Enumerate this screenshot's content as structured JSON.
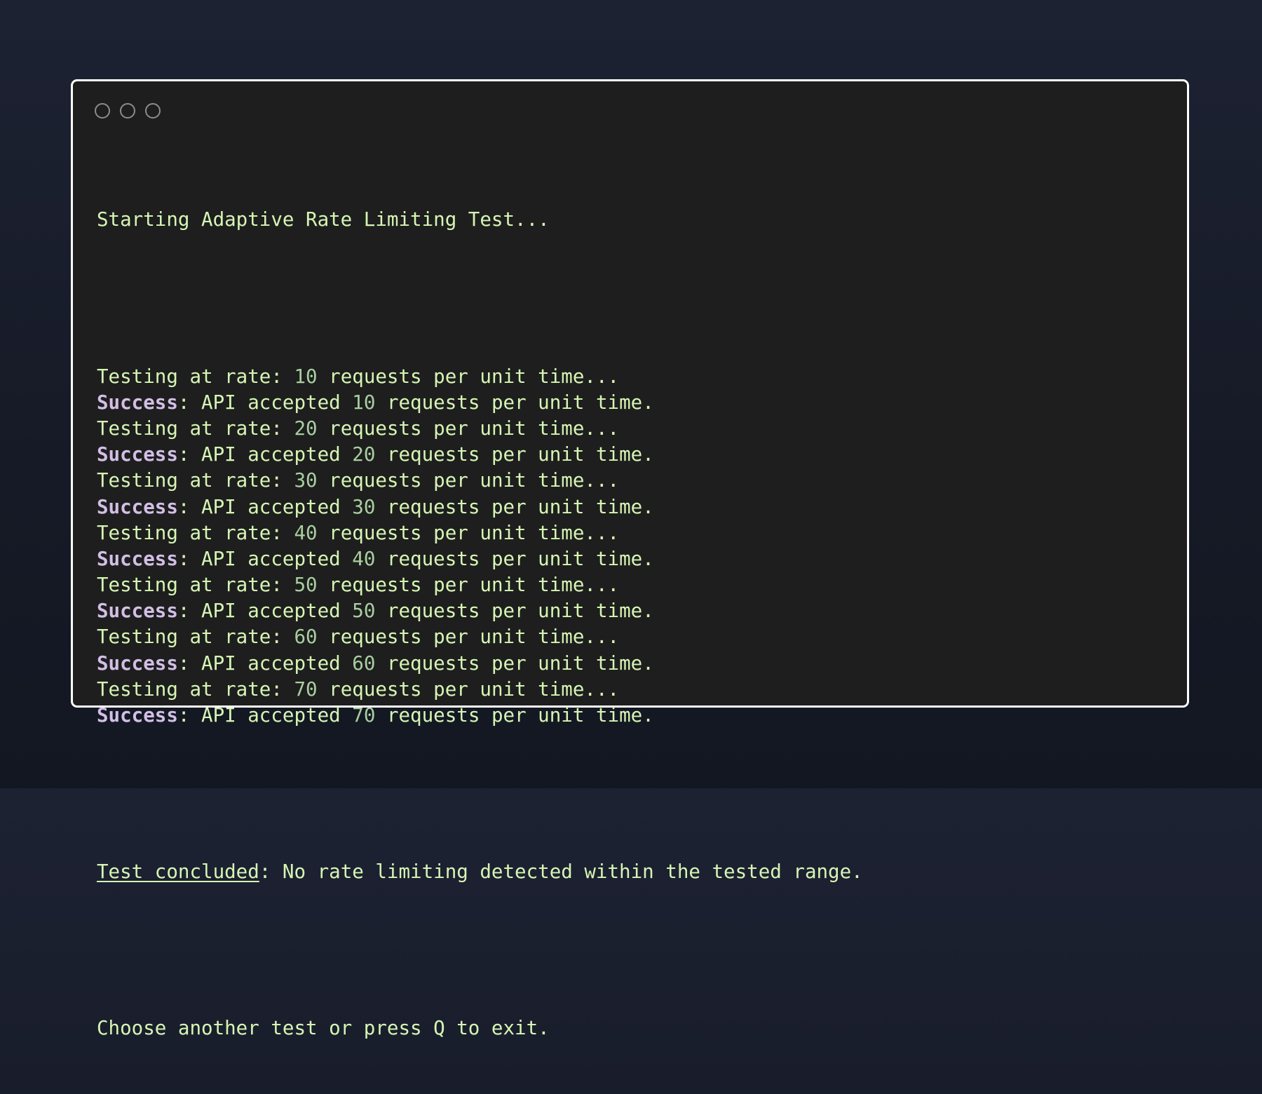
{
  "window": {
    "controls": [
      "close",
      "minimize",
      "maximize"
    ]
  },
  "output": {
    "header": "Starting Adaptive Rate Limiting Test...",
    "tests": [
      {
        "testing_prefix": "Testing at rate: ",
        "rate": "10",
        "testing_suffix": " requests per unit time...",
        "success_label": "Success",
        "success_mid": ": API accepted ",
        "accepted": "10",
        "success_suffix": " requests per unit time."
      },
      {
        "testing_prefix": "Testing at rate: ",
        "rate": "20",
        "testing_suffix": " requests per unit time...",
        "success_label": "Success",
        "success_mid": ": API accepted ",
        "accepted": "20",
        "success_suffix": " requests per unit time."
      },
      {
        "testing_prefix": "Testing at rate: ",
        "rate": "30",
        "testing_suffix": " requests per unit time...",
        "success_label": "Success",
        "success_mid": ": API accepted ",
        "accepted": "30",
        "success_suffix": " requests per unit time."
      },
      {
        "testing_prefix": "Testing at rate: ",
        "rate": "40",
        "testing_suffix": " requests per unit time...",
        "success_label": "Success",
        "success_mid": ": API accepted ",
        "accepted": "40",
        "success_suffix": " requests per unit time."
      },
      {
        "testing_prefix": "Testing at rate: ",
        "rate": "50",
        "testing_suffix": " requests per unit time...",
        "success_label": "Success",
        "success_mid": ": API accepted ",
        "accepted": "50",
        "success_suffix": " requests per unit time."
      },
      {
        "testing_prefix": "Testing at rate: ",
        "rate": "60",
        "testing_suffix": " requests per unit time...",
        "success_label": "Success",
        "success_mid": ": API accepted ",
        "accepted": "60",
        "success_suffix": " requests per unit time."
      },
      {
        "testing_prefix": "Testing at rate: ",
        "rate": "70",
        "testing_suffix": " requests per unit time...",
        "success_label": "Success",
        "success_mid": ": API accepted ",
        "accepted": "70",
        "success_suffix": " requests per unit time."
      }
    ],
    "conclusion_label": "Test concluded",
    "conclusion_text": ": No rate limiting detected within the tested range.",
    "prompt": "Choose another test or press Q to exit."
  },
  "colors": {
    "background": "#1e1e1e",
    "text": "#d6f5b4",
    "number": "#a8cfa0",
    "success": "#d2bfe6",
    "border": "#ffffff"
  }
}
